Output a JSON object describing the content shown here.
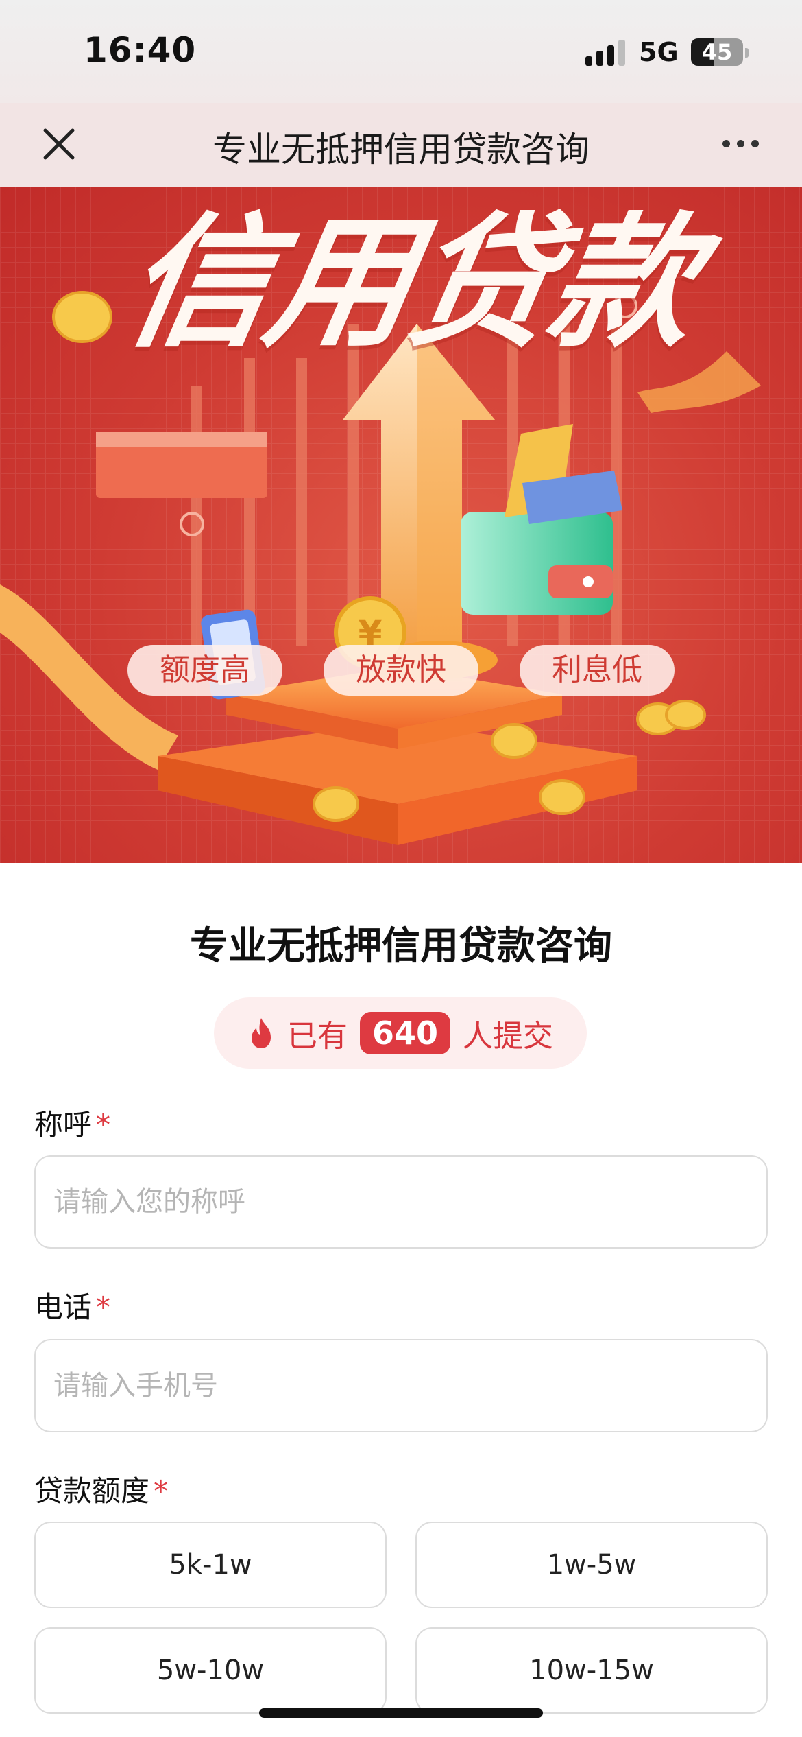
{
  "status_bar": {
    "time": "16:40",
    "network": "5G",
    "battery": "45"
  },
  "nav": {
    "title": "专业无抵押信用贷款咨询",
    "close_icon": "close-icon",
    "more_icon": "more-icon"
  },
  "banner": {
    "headline": "信用贷款",
    "tags": [
      "额度高",
      "放款快",
      "利息低"
    ],
    "accent_color": "#cf3b33"
  },
  "form": {
    "title": "专业无抵押信用贷款咨询",
    "counter": {
      "prefix": "已有",
      "count": "640",
      "suffix": "人提交"
    },
    "fields": [
      {
        "label": "称呼",
        "required_mark": "*",
        "placeholder": "请输入您的称呼",
        "value": ""
      },
      {
        "label": "电话",
        "required_mark": "*",
        "placeholder": "请输入手机号",
        "value": ""
      }
    ],
    "amount": {
      "label": "贷款额度",
      "required_mark": "*",
      "options": [
        "5k-1w",
        "1w-5w",
        "5w-10w",
        "10w-15w"
      ]
    }
  },
  "colors": {
    "brand_red": "#de3a41",
    "counter_bg": "#fdeeee"
  }
}
